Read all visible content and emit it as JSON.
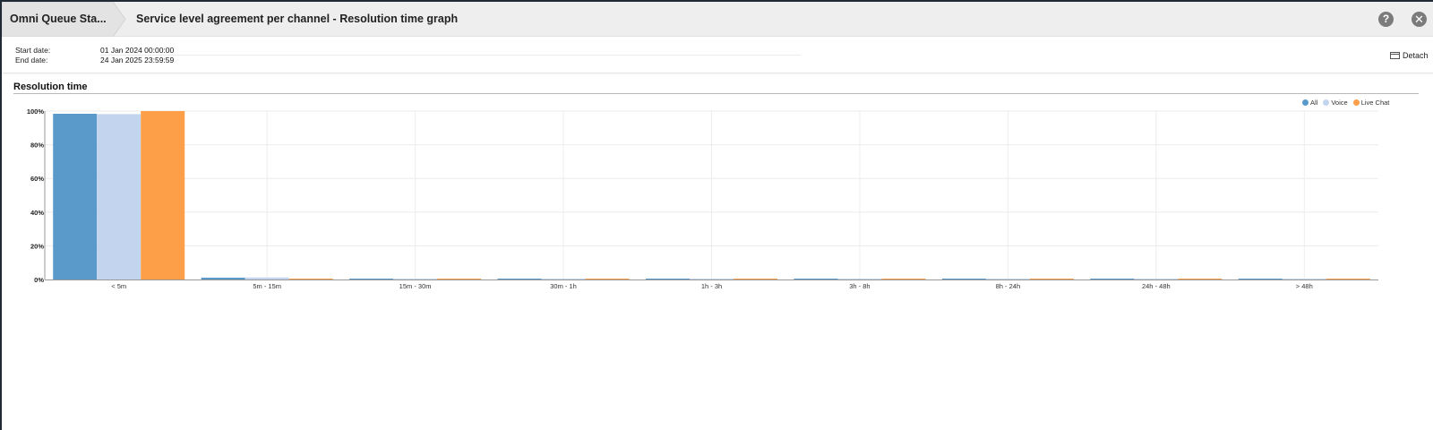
{
  "header": {
    "breadcrumb": "Omni Queue Sta...",
    "title": "Service level agreement per channel - Resolution time graph",
    "help_icon": "question-icon",
    "close_icon": "close-icon"
  },
  "filters": {
    "start_label": "Start date:",
    "start_value": "01 Jan 2024 00:00:00",
    "end_label": "End date:",
    "end_value": "24 Jan 2025 23:59:59"
  },
  "toolbar": {
    "detach_label": "Detach"
  },
  "section": {
    "title": "Resolution time"
  },
  "chart_data": {
    "type": "bar",
    "title": "Resolution time",
    "xlabel": "",
    "ylabel": "",
    "ylim": [
      0,
      100
    ],
    "y_ticks": [
      "0%",
      "20%",
      "40%",
      "60%",
      "80%",
      "100%"
    ],
    "grid": true,
    "legend_position": "top-right",
    "categories": [
      "< 5m",
      "5m - 15m",
      "15m - 30m",
      "30m - 1h",
      "1h - 3h",
      "3h - 8h",
      "8h - 24h",
      "24h - 48h",
      "> 48h"
    ],
    "series": [
      {
        "name": "All",
        "color": "#5a9acb",
        "values": [
          98.4,
          1.1,
          0.2,
          0.1,
          0.1,
          0.05,
          0.05,
          0.05,
          0.05
        ]
      },
      {
        "name": "Voice",
        "color": "#c3d5ee",
        "values": [
          98.2,
          1.2,
          0.2,
          0.1,
          0.1,
          0.05,
          0.05,
          0.05,
          0.05
        ]
      },
      {
        "name": "Live Chat",
        "color": "#fd9f48",
        "values": [
          100,
          0.1,
          0.05,
          0.05,
          0.05,
          0.05,
          0.05,
          0.05,
          0.05
        ]
      }
    ]
  }
}
